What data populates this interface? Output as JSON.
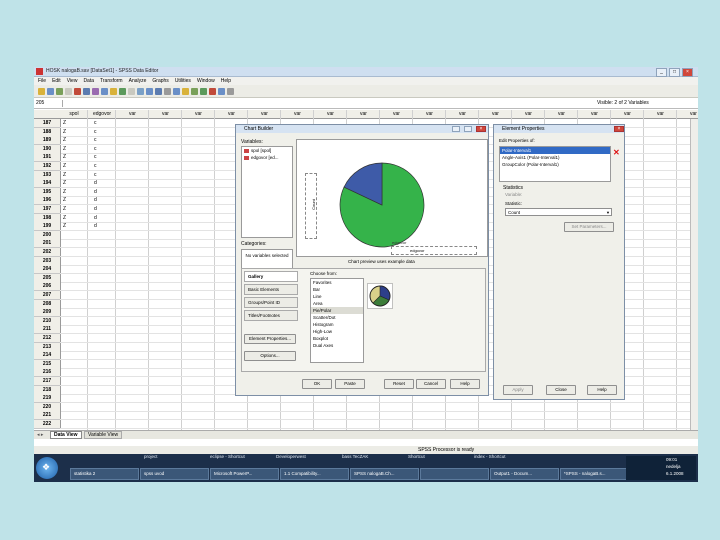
{
  "window": {
    "title": "HOSK nalogaB.sav [DataSet1] - SPSS Data Editor",
    "controls": [
      "_",
      "□",
      "×"
    ]
  },
  "menu": [
    "File",
    "Edit",
    "View",
    "Data",
    "Transform",
    "Analyze",
    "Graphs",
    "Utilities",
    "Window",
    "Help"
  ],
  "cellbar": {
    "ref": "205",
    "visible": "Visible: 2 of 2 Variables"
  },
  "grid": {
    "columns": [
      "spol",
      "edgovor",
      "var",
      "var",
      "var",
      "var",
      "var",
      "var",
      "var",
      "var",
      "var",
      "var",
      "var",
      "var",
      "var",
      "var",
      "var",
      "var",
      "var",
      "var"
    ],
    "rows": [
      {
        "n": "187",
        "spol": "Z",
        "edgovor": "c"
      },
      {
        "n": "188",
        "spol": "Z",
        "edgovor": "c"
      },
      {
        "n": "189",
        "spol": "Z",
        "edgovor": "c"
      },
      {
        "n": "190",
        "spol": "Z",
        "edgovor": "c"
      },
      {
        "n": "191",
        "spol": "Z",
        "edgovor": "c"
      },
      {
        "n": "192",
        "spol": "Z",
        "edgovor": "c"
      },
      {
        "n": "193",
        "spol": "Z",
        "edgovor": "c"
      },
      {
        "n": "194",
        "spol": "Z",
        "edgovor": "d"
      },
      {
        "n": "195",
        "spol": "Z",
        "edgovor": "d"
      },
      {
        "n": "196",
        "spol": "Z",
        "edgovor": "d"
      },
      {
        "n": "197",
        "spol": "Z",
        "edgovor": "d"
      },
      {
        "n": "198",
        "spol": "Z",
        "edgovor": "d"
      },
      {
        "n": "199",
        "spol": "Z",
        "edgovor": "d"
      },
      {
        "n": "200",
        "spol": "",
        "edgovor": ""
      },
      {
        "n": "201",
        "spol": "",
        "edgovor": ""
      },
      {
        "n": "202",
        "spol": "",
        "edgovor": ""
      },
      {
        "n": "203",
        "spol": "",
        "edgovor": ""
      },
      {
        "n": "204",
        "spol": "",
        "edgovor": ""
      },
      {
        "n": "205",
        "spol": "",
        "edgovor": ""
      },
      {
        "n": "206",
        "spol": "",
        "edgovor": ""
      },
      {
        "n": "207",
        "spol": "",
        "edgovor": ""
      },
      {
        "n": "208",
        "spol": "",
        "edgovor": ""
      },
      {
        "n": "209",
        "spol": "",
        "edgovor": ""
      },
      {
        "n": "210",
        "spol": "",
        "edgovor": ""
      },
      {
        "n": "211",
        "spol": "",
        "edgovor": ""
      },
      {
        "n": "212",
        "spol": "",
        "edgovor": ""
      },
      {
        "n": "213",
        "spol": "",
        "edgovor": ""
      },
      {
        "n": "214",
        "spol": "",
        "edgovor": ""
      },
      {
        "n": "215",
        "spol": "",
        "edgovor": ""
      },
      {
        "n": "216",
        "spol": "",
        "edgovor": ""
      },
      {
        "n": "217",
        "spol": "",
        "edgovor": ""
      },
      {
        "n": "218",
        "spol": "",
        "edgovor": ""
      },
      {
        "n": "219",
        "spol": "",
        "edgovor": ""
      },
      {
        "n": "220",
        "spol": "",
        "edgovor": ""
      },
      {
        "n": "221",
        "spol": "",
        "edgovor": ""
      },
      {
        "n": "222",
        "spol": "",
        "edgovor": ""
      }
    ]
  },
  "sheet_tabs": [
    "Data View",
    "Variable View"
  ],
  "status": {
    "processor": "SPSS Processor is ready"
  },
  "chart_builder": {
    "title": "Chart Builder",
    "variables_label": "Variables:",
    "variables": [
      "spol [spol]",
      "edgovor [ed..."
    ],
    "categories_label": "Categories:",
    "categories_text": "No variables selected",
    "y_drop": "Count",
    "x_drop_label": "edgovor",
    "legend_drop": "edgovor",
    "preview_note": "Chart preview uses example data",
    "gallery_tabs": [
      "Gallery",
      "Basic Elements",
      "Groups/Point ID",
      "Titles/Footnotes"
    ],
    "choose_from_label": "Choose from:",
    "choose_from": [
      "Favorites",
      "Bar",
      "Line",
      "Area",
      "Pie/Polar",
      "Scatter/Dot",
      "Histogram",
      "High-Low",
      "Boxplot",
      "Dual Axes"
    ],
    "selected_choice": "Pie/Polar",
    "side_buttons": [
      "Element Properties...",
      "Options..."
    ],
    "footer_buttons": [
      "OK",
      "Paste",
      "Reset",
      "Cancel",
      "Help"
    ]
  },
  "element_properties": {
    "title": "Element Properties",
    "edit_label": "Edit Properties of:",
    "items": [
      "Polar-Interval1",
      "Angle-Axis1 (Polar-Interval1)",
      "GroupColor (Polar-Interval1)"
    ],
    "selected_item": "Polar-Interval1",
    "statistics_label": "Statistics",
    "variable_label": "Variable:",
    "statistic_label": "Statistic:",
    "statistic_value": "Count",
    "set_parameters": "Set Parameters...",
    "footer_buttons": [
      "Apply",
      "Close",
      "Help"
    ]
  },
  "pie_preview": {
    "slices": [
      {
        "label": "green",
        "fraction": 0.82,
        "color": "#35b34a"
      },
      {
        "label": "blue",
        "fraction": 0.18,
        "color": "#3e5ba8"
      }
    ]
  },
  "taskbar": {
    "buttons": [
      "statistika 2",
      "spss uvod",
      "Microsoft PowerP...",
      "1.1 Compatibility...",
      "SPSS nalogaB.Ch...",
      "",
      "Output1 - Docum...",
      "*SPSS - nalogaB.s..."
    ],
    "quick": [
      "project",
      "eclipse - Shortcut",
      "Developerwest",
      "bass TecZAK",
      "Shortcut",
      "index - Shortcut"
    ],
    "clock_time": "09:01",
    "clock_day": "nedelja",
    "clock_date": "6.1.2008"
  },
  "colors": {
    "spss_green": "#35b34a",
    "spss_blue": "#3e5ba8",
    "selection": "#316ac5"
  }
}
